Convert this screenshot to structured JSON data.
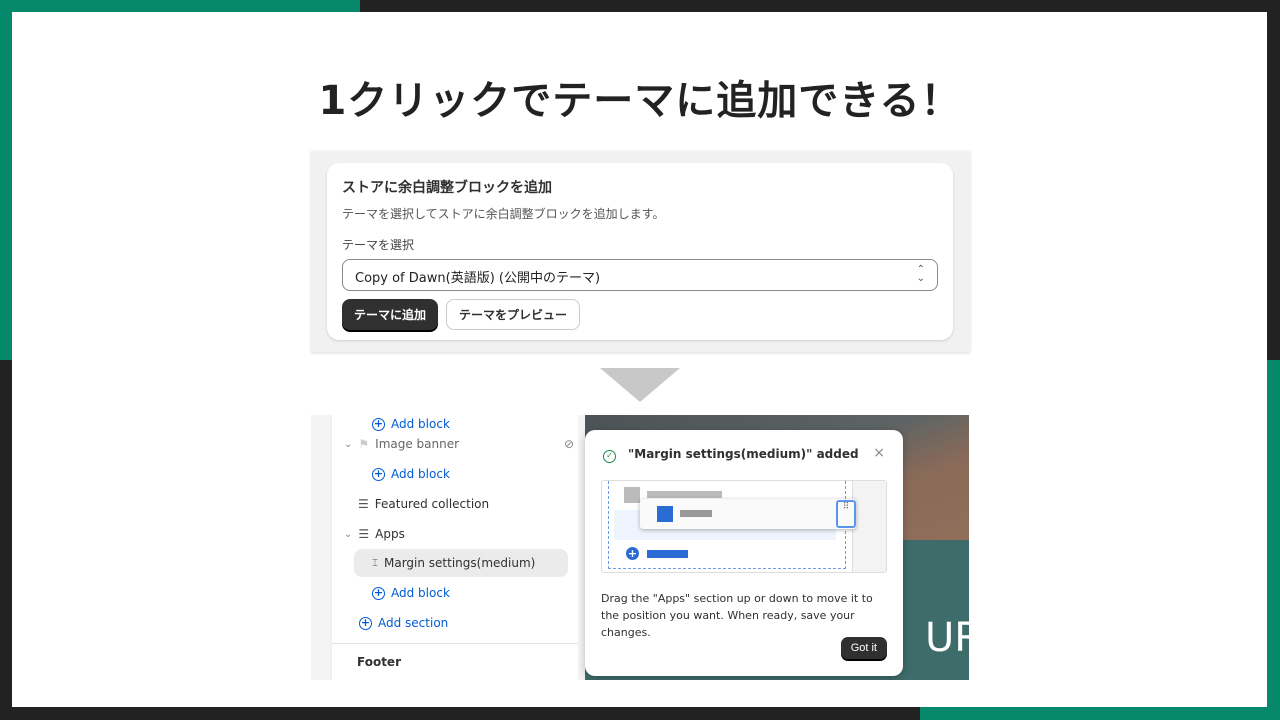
{
  "headline": "1クリックでテーマに追加できる！",
  "install_card": {
    "title": "ストアに余白調整ブロックを追加",
    "description": "テーマを選択してストアに余白調整ブロックを追加します。",
    "select_label": "テーマを選択",
    "select_value": "Copy of Dawn(英語版) (公開中のテーマ)",
    "add_button": "テーマに追加",
    "preview_button": "テーマをプレビュー"
  },
  "editor": {
    "sidebar": {
      "items": [
        {
          "label": "Add block",
          "type": "add"
        },
        {
          "label": "Image banner",
          "type": "section"
        },
        {
          "label": "Add block",
          "type": "add"
        },
        {
          "label": "Featured collection",
          "type": "section"
        },
        {
          "label": "Apps",
          "type": "section"
        },
        {
          "label": "Margin settings(medium)",
          "type": "block",
          "selected": true
        },
        {
          "label": "Add block",
          "type": "add"
        },
        {
          "label": "Add section",
          "type": "add"
        }
      ],
      "footer": "Footer"
    },
    "popover": {
      "title": "\"Margin settings(medium)\" added",
      "body": "Drag the \"Apps\" section up or down to move it to the position you want. When ready, save your changes.",
      "button": "Got it"
    },
    "preview_text": "UR"
  },
  "colors": {
    "accent": "#06896a",
    "link": "#005bd3",
    "primary_button": "#303030"
  }
}
